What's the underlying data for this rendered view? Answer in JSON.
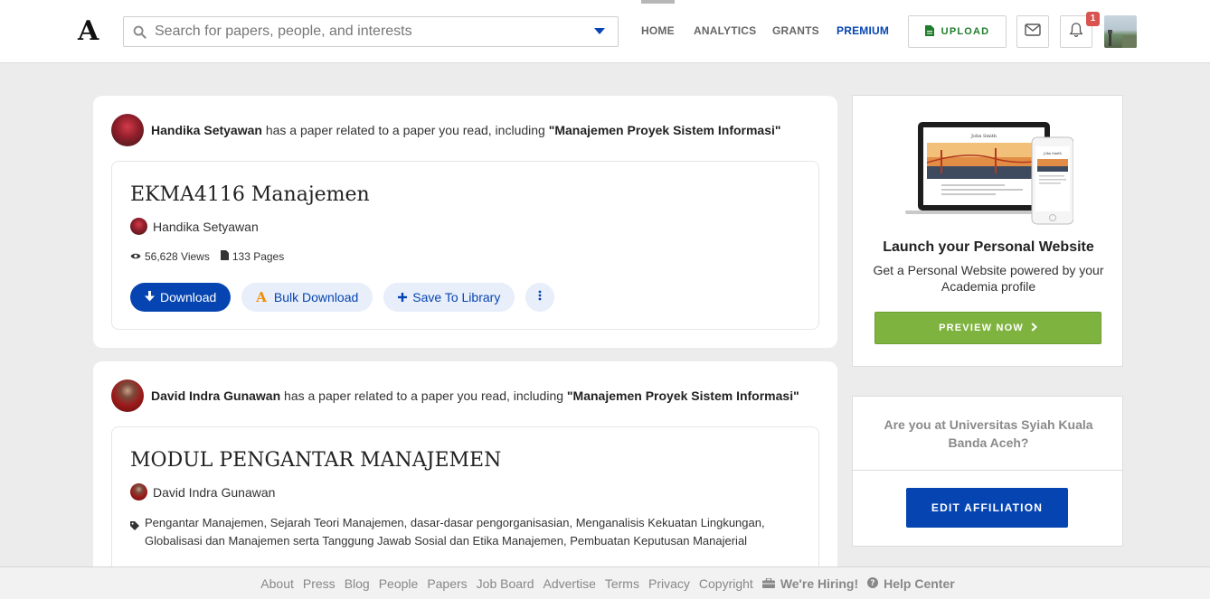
{
  "header": {
    "logo": "A",
    "search_placeholder": "Search for papers, people, and interests",
    "nav": [
      "HOME",
      "ANALYTICS",
      "GRANTS",
      "PREMIUM"
    ],
    "upload_label": "UPLOAD",
    "notification_count": "1"
  },
  "feed": [
    {
      "recommender": "Handika Setyawan",
      "reason": " has a paper related to a paper you read, including ",
      "related": "\"Manajemen Proyek Sistem Informasi\"",
      "title": "EKMA4116 Manajemen",
      "author": "Handika Setyawan",
      "views": "56,628 Views",
      "pages": "133 Pages",
      "actions": {
        "download": "Download",
        "bulk": "Bulk Download",
        "save": "Save To Library"
      }
    },
    {
      "recommender": "David Indra Gunawan",
      "reason": " has a paper related to a paper you read, including ",
      "related": "\"Manajemen Proyek Sistem Informasi\"",
      "title": "MODUL PENGANTAR MANAJEMEN",
      "author": "David Indra Gunawan",
      "tags": "Pengantar Manajemen, Sejarah Teori Manajemen, dasar-dasar pengorganisasian, Menganalisis Kekuatan Lingkungan, Globalisasi dan Manajemen serta Tanggung Jawab Sosial dan Etika Manajemen, Pembuatan Keputusan Manajerial"
    }
  ],
  "sidebar": {
    "website": {
      "title": "Launch your Personal Website",
      "subtitle": "Get a Personal Website powered by your Academia profile",
      "button": "PREVIEW NOW",
      "mock_name": "John Smith"
    },
    "affiliation": {
      "question": "Are you at Universitas Syiah Kuala Banda Aceh?",
      "button": "EDIT AFFILIATION"
    }
  },
  "footer": {
    "links": [
      "About",
      "Press",
      "Blog",
      "People",
      "Papers",
      "Job Board",
      "Advertise",
      "Terms",
      "Privacy",
      "Copyright"
    ],
    "hiring": "We're Hiring!",
    "help": "Help Center"
  },
  "colors": {
    "brand_blue": "#0645b1",
    "upload_green": "#1e7d2b",
    "preview_green": "#7fb33f",
    "badge_red": "#d9534f"
  }
}
